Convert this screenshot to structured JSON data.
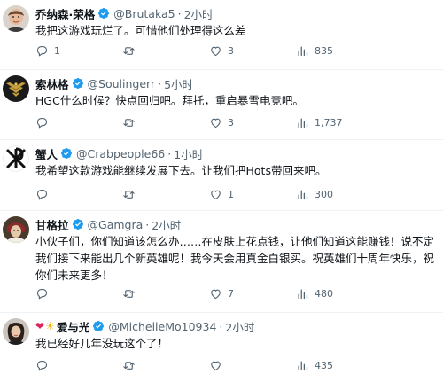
{
  "tweets": [
    {
      "name": "乔纳森·荣格",
      "handle": "@Brutaka5",
      "time": "2小时",
      "text": "我把这游戏玩烂了。可惜他们处理得这么差",
      "replies": "1",
      "retweets": "",
      "likes": "3",
      "views": "835"
    },
    {
      "name": "索林格",
      "handle": "@Soulingerr",
      "time": "5小时",
      "text": "HGC什么时候？快点回归吧。拜托，重启暴雪电竞吧。",
      "replies": "",
      "retweets": "",
      "likes": "3",
      "views": "1,737"
    },
    {
      "name": "蟹人",
      "handle": "@Crabpeople66",
      "time": "1小时",
      "text": "我希望这款游戏能继续发展下去。让我们把Hots带回来吧。",
      "replies": "",
      "retweets": "",
      "likes": "1",
      "views": "300"
    },
    {
      "name": "甘格拉",
      "handle": "@Gamgra",
      "time": "2小时",
      "text": "小伙子们，你们知道该怎么办……在皮肤上花点钱，让他们知道这能赚钱！说不定我们接下来能出几个新英雄呢！我今天会用真金白银买。祝英雄们十周年快乐，祝你们未来更多！",
      "replies": "",
      "retweets": "",
      "likes": "7",
      "views": "480"
    },
    {
      "name": "爱与光",
      "handle": "@MichelleMo10934",
      "time": "2小时",
      "text": "我已经好几年没玩这个了！",
      "replies": "",
      "retweets": "",
      "likes": "",
      "views": "435"
    }
  ],
  "colors": {
    "verified": "#1d9bf0",
    "muted": "#536471",
    "text": "#0f1419",
    "divider": "#eff3f4"
  },
  "icons": [
    "verified-badge-icon",
    "reply-icon",
    "retweet-icon",
    "like-icon",
    "views-icon",
    "heart-emoji-icon",
    "sun-emoji-icon"
  ]
}
